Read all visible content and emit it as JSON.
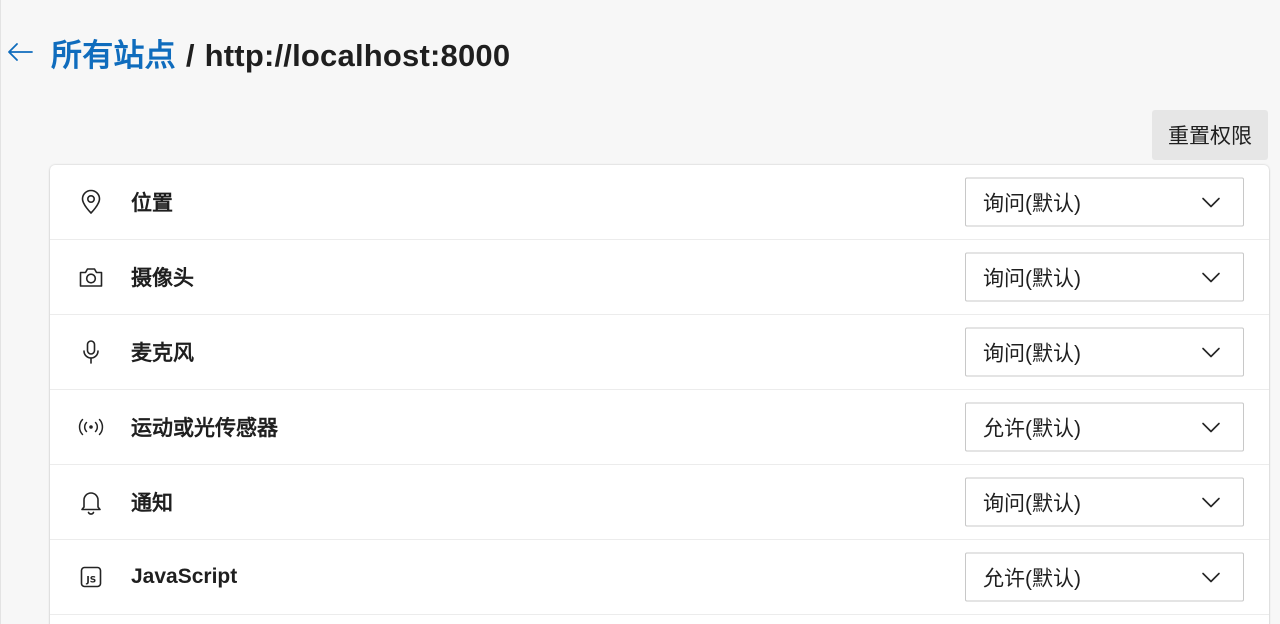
{
  "header": {
    "breadcrumb_parent": "所有站点",
    "separator": "/",
    "breadcrumb_current": "http://localhost:8000"
  },
  "toolbar": {
    "reset_label": "重置权限"
  },
  "colors": {
    "accent": "#0f6cbd",
    "background": "#f7f7f7",
    "card": "#ffffff",
    "reset_button_bg": "#e6e6e6"
  },
  "permissions": [
    {
      "icon": "location-icon",
      "label": "位置",
      "value": "询问(默认)"
    },
    {
      "icon": "camera-icon",
      "label": "摄像头",
      "value": "询问(默认)"
    },
    {
      "icon": "microphone-icon",
      "label": "麦克风",
      "value": "询问(默认)"
    },
    {
      "icon": "motion-sensor-icon",
      "label": "运动或光传感器",
      "value": "允许(默认)"
    },
    {
      "icon": "bell-icon",
      "label": "通知",
      "value": "询问(默认)"
    },
    {
      "icon": "javascript-icon",
      "label": "JavaScript",
      "value": "允许(默认)"
    }
  ]
}
